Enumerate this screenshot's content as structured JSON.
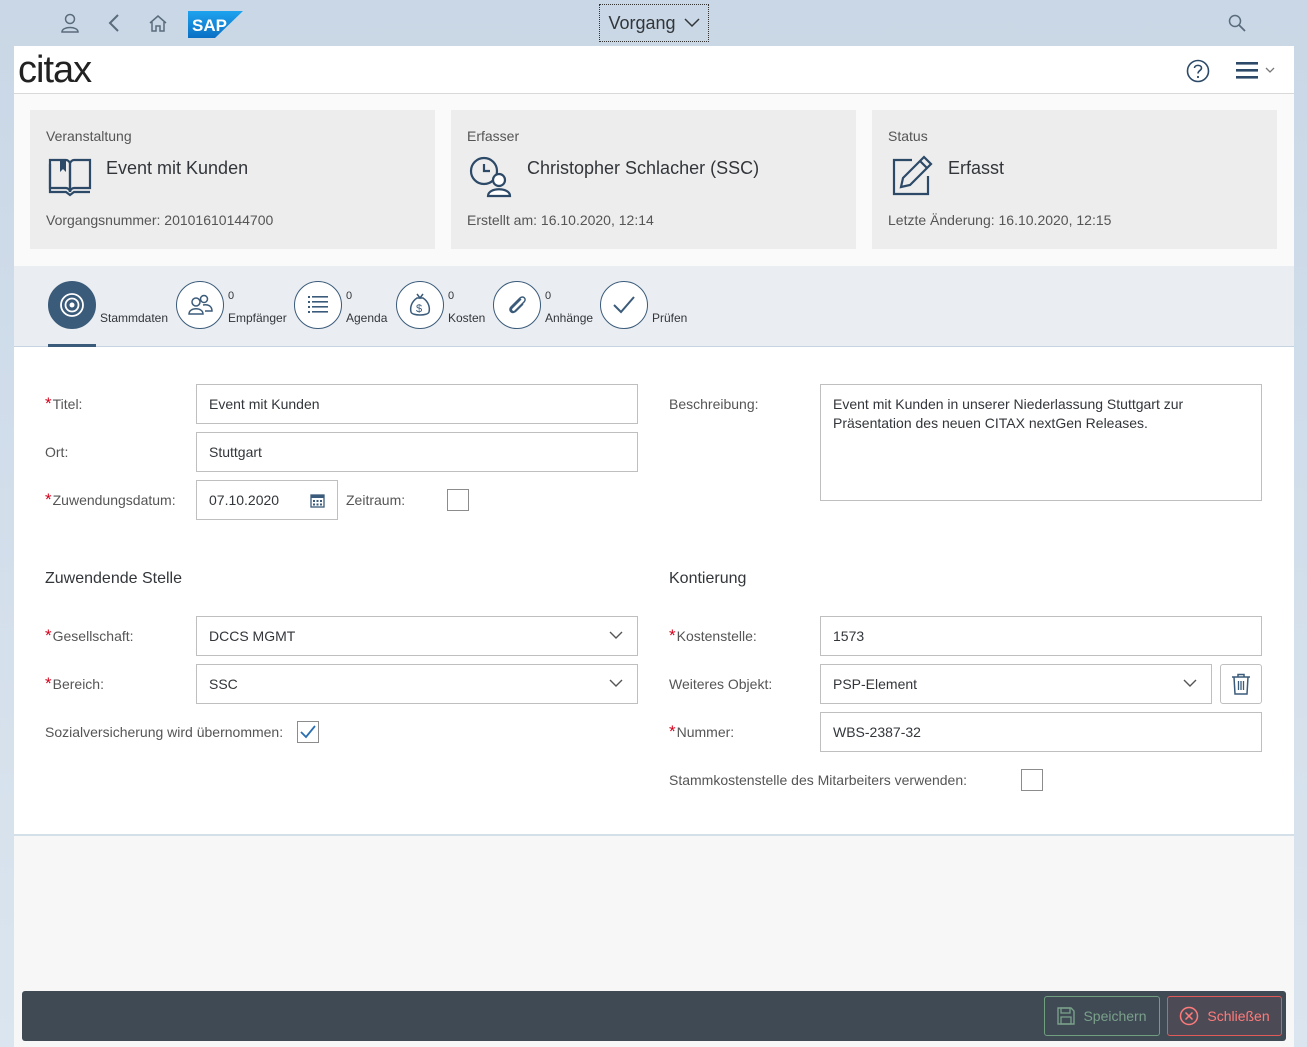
{
  "shell": {
    "app_title": "Vorgang",
    "sap_logo_text": "SAP",
    "icons": [
      "user-icon",
      "back-icon",
      "home-icon",
      "search-icon"
    ]
  },
  "header": {
    "logo_text": "citax",
    "icons": [
      "help-icon",
      "menu-icon"
    ]
  },
  "cards": [
    {
      "label": "Veranstaltung",
      "value": "Event mit Kunden",
      "sub": "Vorgangsnummer: 20101610144700",
      "icon": "book-icon"
    },
    {
      "label": "Erfasser",
      "value": "Christopher Schlacher (SSC)",
      "sub": "Erstellt am: 16.10.2020, 12:14",
      "icon": "user-clock-icon"
    },
    {
      "label": "Status",
      "value": "Erfasst",
      "sub": "Letzte Änderung: 16.10.2020, 12:15",
      "icon": "edit-icon"
    }
  ],
  "tabs": [
    {
      "label": "Stammdaten",
      "count": "",
      "icon": "target-icon",
      "active": true
    },
    {
      "label": "Empfänger",
      "count": "0",
      "icon": "people-icon"
    },
    {
      "label": "Agenda",
      "count": "0",
      "icon": "list-icon"
    },
    {
      "label": "Kosten",
      "count": "0",
      "icon": "money-bag-icon"
    },
    {
      "label": "Anhänge",
      "count": "0",
      "icon": "paperclip-icon"
    },
    {
      "label": "Prüfen",
      "count": "",
      "icon": "checkmark-icon"
    }
  ],
  "form": {
    "titel_label": "Titel:",
    "titel_value": "Event mit Kunden",
    "ort_label": "Ort:",
    "ort_value": "Stuttgart",
    "datum_label": "Zuwendungsdatum:",
    "datum_value": "07.10.2020",
    "zeitraum_label": "Zeitraum:",
    "zeitraum_checked": false,
    "beschreibung_label": "Beschreibung:",
    "beschreibung_value": "Event mit Kunden in unserer Niederlassung Stuttgart zur Präsentation des neuen CITAX nextGen Releases.",
    "zuwendende_title": "Zuwendende Stelle",
    "gesellschaft_label": "Gesellschaft:",
    "gesellschaft_value": "DCCS MGMT",
    "bereich_label": "Bereich:",
    "bereich_value": "SSC",
    "sozial_label": "Sozialversicherung wird übernommen:",
    "sozial_checked": true,
    "kontierung_title": "Kontierung",
    "kostenstelle_label": "Kostenstelle:",
    "kostenstelle_value": "1573",
    "objekt_label": "Weiteres Objekt:",
    "objekt_value": "PSP-Element",
    "nummer_label": "Nummer:",
    "nummer_value": "WBS-2387-32",
    "stamm_label": "Stammkostenstelle des Mitarbeiters verwenden:",
    "stamm_checked": false,
    "required_marker": "*"
  },
  "footer": {
    "save_label": "Speichern",
    "close_label": "Schließen"
  },
  "colors": {
    "accent": "#3b5b7a",
    "required": "#d0021b",
    "footer_bg": "#3f4a55",
    "save": "#7aa08a",
    "close": "#ff7b7b"
  }
}
